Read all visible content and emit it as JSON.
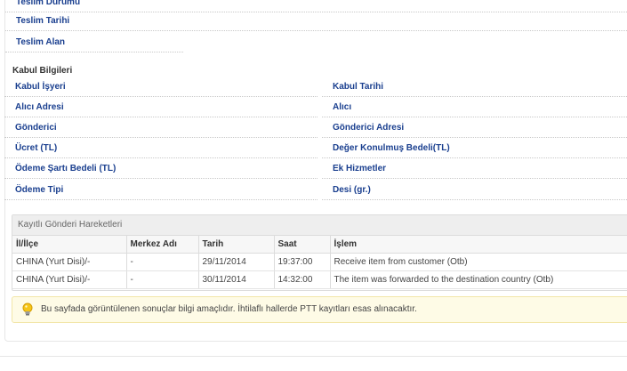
{
  "teslim": {
    "rows": [
      "Teslim Durumu",
      "Teslim Tarihi",
      "Teslim Alan"
    ]
  },
  "kabul": {
    "title": "Kabul Bilgileri",
    "left": [
      "Kabul İşyeri",
      "Alıcı Adresi",
      "Gönderici",
      "Ücret (TL)",
      "Ödeme Şartı Bedeli (TL)",
      "Ödeme Tipi"
    ],
    "right": [
      "Kabul Tarihi",
      "Alıcı",
      "Gönderici Adresi",
      "Değer Konulmuş Bedeli(TL)",
      "Ek Hizmetler",
      "Desi (gr.)"
    ]
  },
  "hareket": {
    "title": "Kayıtlı Gönderi Hareketleri",
    "columns": [
      "İl/İlçe",
      "Merkez Adı",
      "Tarih",
      "Saat",
      "İşlem"
    ],
    "rows": [
      [
        "CHINA (Yurt Disi)/-",
        "-",
        "29/11/2014",
        "19:37:00",
        "Receive item from customer (Otb)"
      ],
      [
        "CHINA (Yurt Disi)/-",
        "-",
        "30/11/2014",
        "14:32:00",
        "The item was forwarded to the destination country (Otb)"
      ]
    ]
  },
  "notice": {
    "icon": "lightbulb-icon",
    "text": "Bu sayfada görüntülenen sonuçlar bilgi amaçlıdır. İhtilaflı hallerde PTT kayıtları esas alınacaktır."
  },
  "colors": {
    "label": "#1a3f8f",
    "notice_bg": "#fefbe6"
  }
}
